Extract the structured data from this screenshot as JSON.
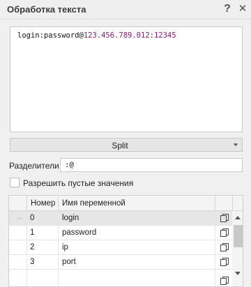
{
  "window": {
    "title": "Обработка текста",
    "help": "?",
    "close": "✕"
  },
  "editor": {
    "text_plain": "login:password@",
    "text_highlight": "123.456.789.012:12345"
  },
  "split_button": {
    "label": "Split"
  },
  "separators": {
    "label": "Разделители",
    "value": ":@"
  },
  "allow_empty": {
    "label": "Разрешить пустые значения",
    "checked": false
  },
  "grid": {
    "columns": {
      "number": "Номер",
      "variable": "Имя переменной"
    },
    "current_row_indicator": "→",
    "rows": [
      {
        "number": "0",
        "variable": "login"
      },
      {
        "number": "1",
        "variable": "password"
      },
      {
        "number": "2",
        "variable": "ip"
      },
      {
        "number": "3",
        "variable": "port"
      }
    ]
  }
}
